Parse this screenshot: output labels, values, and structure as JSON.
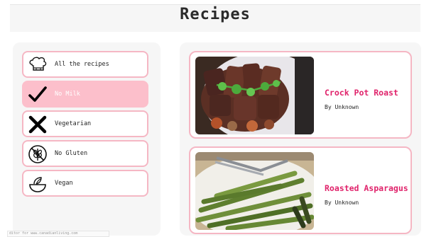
{
  "header": {
    "title": "Recipes"
  },
  "categories": [
    {
      "label": "All the recipes",
      "icon": "chef-hat-icon",
      "active": false
    },
    {
      "label": "No Milk",
      "icon": "checkmark-icon",
      "active": true
    },
    {
      "label": "Vegetarian",
      "icon": "x-icon",
      "active": false
    },
    {
      "label": "No Gluten",
      "icon": "wheat-icon",
      "active": false
    },
    {
      "label": "Vegan",
      "icon": "bowl-icon",
      "active": false
    }
  ],
  "recipes": [
    {
      "title": "Crock Pot Roast",
      "author": "By Unknown",
      "image": "roast-beef-photo"
    },
    {
      "title": "Roasted Asparagus",
      "author": "By Unknown",
      "image": "asparagus-photo"
    }
  ],
  "footer": {
    "link_text": "ditor for www.canadianliving.com"
  },
  "colors": {
    "accent": "#e0236b",
    "border": "#f5b7c4",
    "active_bg": "#fcbfcb",
    "panel_bg": "#f6f6f6"
  }
}
